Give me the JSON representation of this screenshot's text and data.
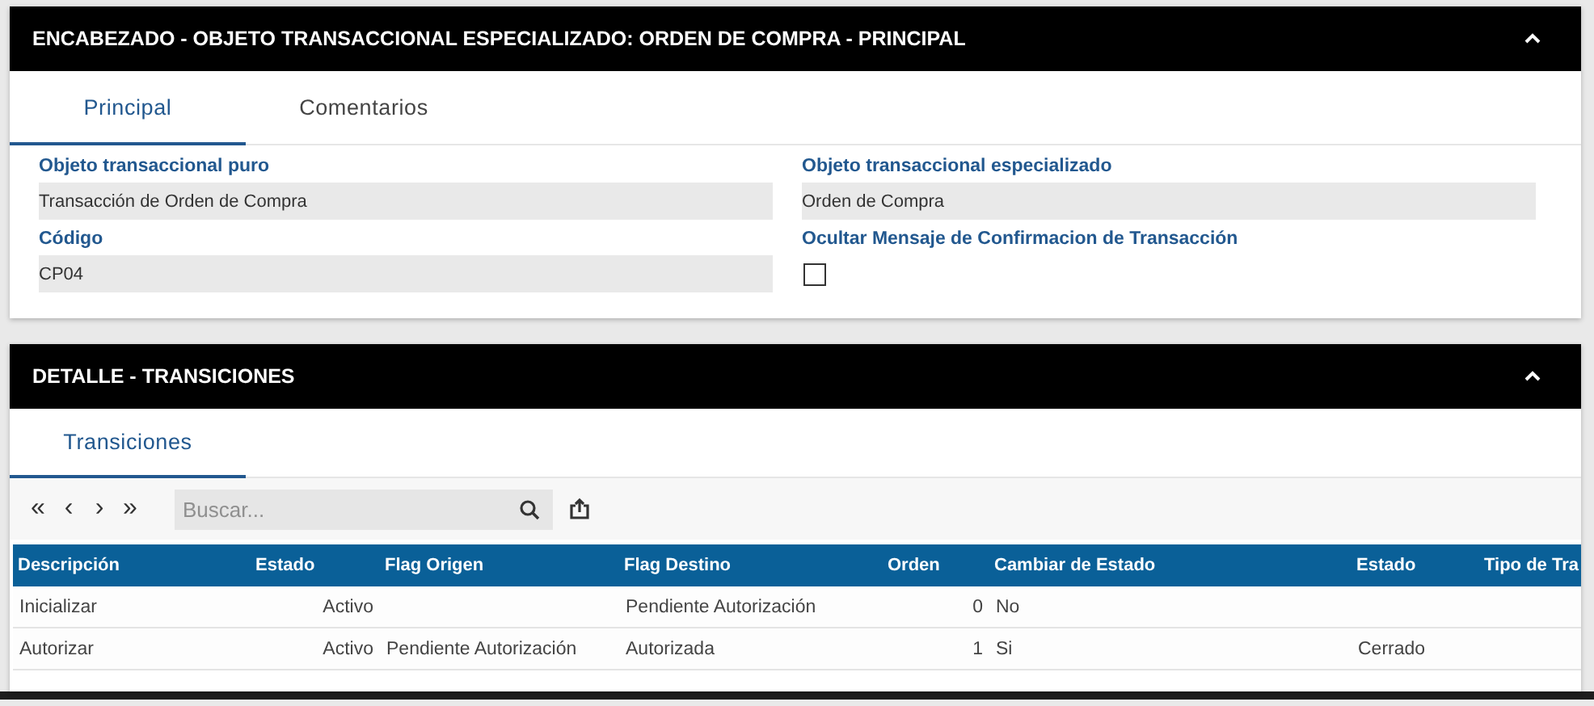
{
  "header_panel": {
    "title": "ENCABEZADO - OBJETO TRANSACCIONAL ESPECIALIZADO: ORDEN DE COMPRA - PRINCIPAL",
    "expanded": true,
    "tabs": [
      {
        "label": "Principal",
        "selected": true
      },
      {
        "label": "Comentarios",
        "selected": false
      }
    ],
    "fields": [
      {
        "kind": "text",
        "label": "Objeto transaccional puro",
        "value": "Transacción de Orden de Compra"
      },
      {
        "kind": "text",
        "label": "Objeto transaccional especializado",
        "value": "Orden de Compra"
      },
      {
        "kind": "text",
        "label": "Código",
        "value": "CP04"
      },
      {
        "kind": "checkbox",
        "label": "Ocultar Mensaje de Confirmacion de Transacción",
        "checked": false
      }
    ]
  },
  "detail_panel": {
    "title": "DETALLE - TRANSICIONES",
    "expanded": true,
    "tabs": [
      {
        "label": "Transiciones",
        "selected": true
      }
    ],
    "toolbar": {
      "nav": [
        "«",
        "‹",
        "›",
        "»"
      ],
      "search": {
        "placeholder": "Buscar..."
      }
    },
    "table": {
      "columns": [
        "Descripción",
        "Estado",
        "Flag Origen",
        "Flag Destino",
        "Orden",
        "Cambiar de Estado",
        "Estado",
        "Tipo de Tra"
      ],
      "rows": [
        [
          "Inicializar",
          "Activo",
          "",
          "Pendiente Autorización",
          "0",
          "No",
          ""
        ],
        [
          "Autorizar",
          "Activo",
          "Pendiente Autorización",
          "Autorizada",
          "1",
          "Si",
          "Cerrado"
        ]
      ]
    }
  }
}
